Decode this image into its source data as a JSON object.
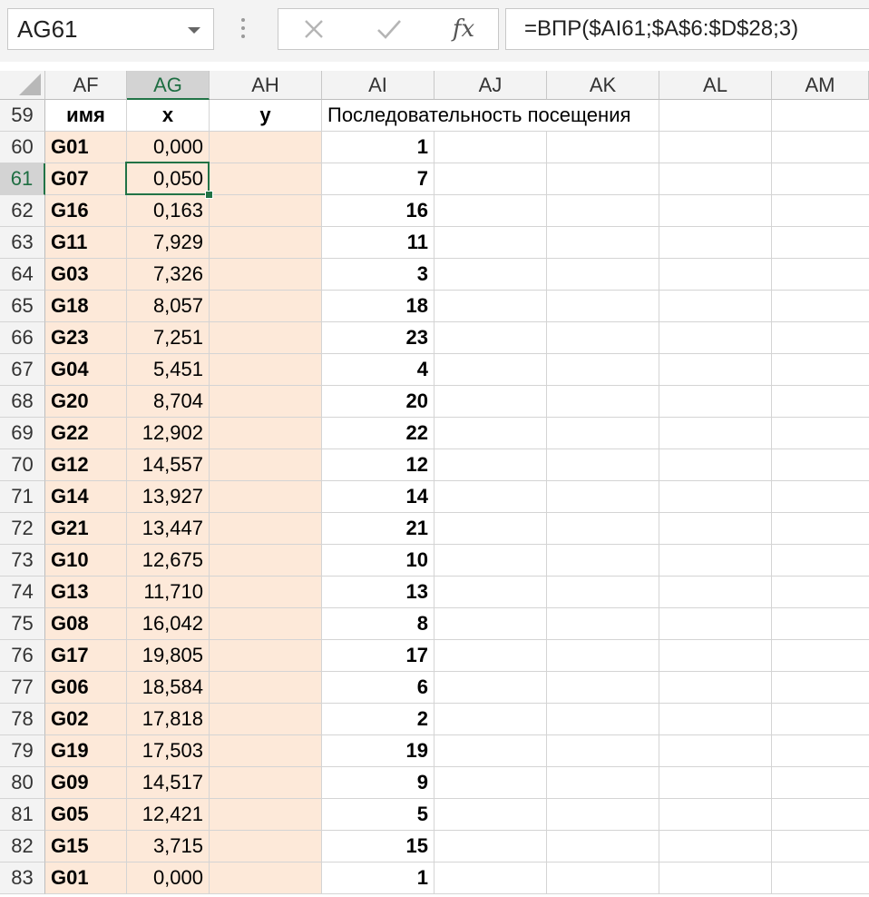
{
  "name_box": {
    "value": "AG61"
  },
  "formula_bar": {
    "formula": "=ВПР($AI61;$A$6:$D$28;3)",
    "fx_label": "fx"
  },
  "columns": [
    "AF",
    "AG",
    "AH",
    "AI",
    "AJ",
    "AK",
    "AL",
    "AM"
  ],
  "selected_column": "AG",
  "selected_row": 61,
  "header_row": {
    "row_num": "59",
    "af": "имя",
    "ag": "x",
    "ah": "y",
    "ai": "Последовательность посещения"
  },
  "rows": [
    {
      "num": "60",
      "name": "G01",
      "x": "0,000",
      "seq": "1"
    },
    {
      "num": "61",
      "name": "G07",
      "x": "0,050",
      "seq": "7"
    },
    {
      "num": "62",
      "name": "G16",
      "x": "0,163",
      "seq": "16"
    },
    {
      "num": "63",
      "name": "G11",
      "x": "7,929",
      "seq": "11"
    },
    {
      "num": "64",
      "name": "G03",
      "x": "7,326",
      "seq": "3"
    },
    {
      "num": "65",
      "name": "G18",
      "x": "8,057",
      "seq": "18"
    },
    {
      "num": "66",
      "name": "G23",
      "x": "7,251",
      "seq": "23"
    },
    {
      "num": "67",
      "name": "G04",
      "x": "5,451",
      "seq": "4"
    },
    {
      "num": "68",
      "name": "G20",
      "x": "8,704",
      "seq": "20"
    },
    {
      "num": "69",
      "name": "G22",
      "x": "12,902",
      "seq": "22"
    },
    {
      "num": "70",
      "name": "G12",
      "x": "14,557",
      "seq": "12"
    },
    {
      "num": "71",
      "name": "G14",
      "x": "13,927",
      "seq": "14"
    },
    {
      "num": "72",
      "name": "G21",
      "x": "13,447",
      "seq": "21"
    },
    {
      "num": "73",
      "name": "G10",
      "x": "12,675",
      "seq": "10"
    },
    {
      "num": "74",
      "name": "G13",
      "x": "11,710",
      "seq": "13"
    },
    {
      "num": "75",
      "name": "G08",
      "x": "16,042",
      "seq": "8"
    },
    {
      "num": "76",
      "name": "G17",
      "x": "19,805",
      "seq": "17"
    },
    {
      "num": "77",
      "name": "G06",
      "x": "18,584",
      "seq": "6"
    },
    {
      "num": "78",
      "name": "G02",
      "x": "17,818",
      "seq": "2"
    },
    {
      "num": "79",
      "name": "G19",
      "x": "17,503",
      "seq": "19"
    },
    {
      "num": "80",
      "name": "G09",
      "x": "14,517",
      "seq": "9"
    },
    {
      "num": "81",
      "name": "G05",
      "x": "12,421",
      "seq": "5"
    },
    {
      "num": "82",
      "name": "G15",
      "x": "3,715",
      "seq": "15"
    },
    {
      "num": "83",
      "name": "G01",
      "x": "0,000",
      "seq": "1"
    }
  ],
  "colors": {
    "accent": "#217346",
    "fill": "#fde9d9",
    "header_bg": "#f3f3f3"
  }
}
